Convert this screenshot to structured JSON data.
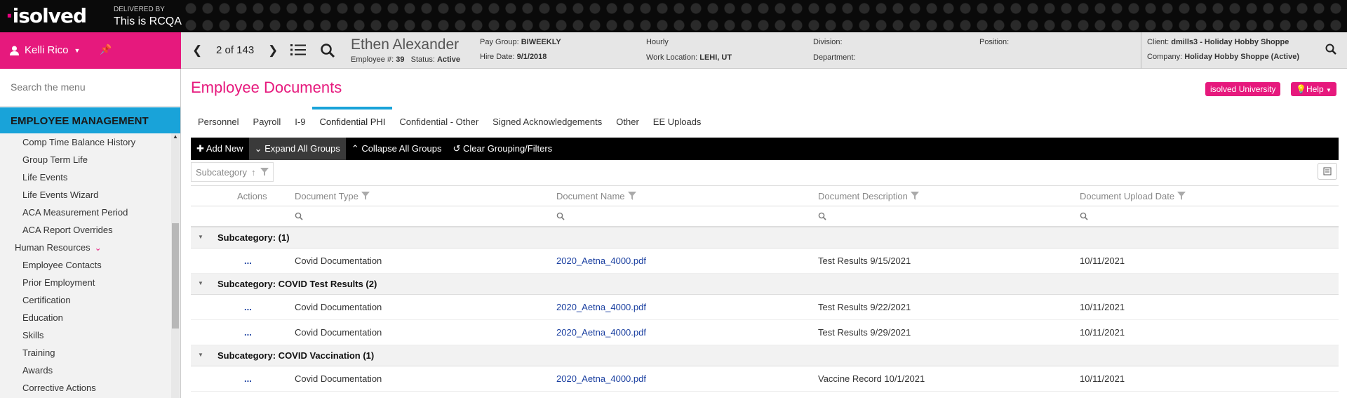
{
  "banner": {
    "logo": "isolved",
    "delivered_by": "DELIVERED BY",
    "tenant": "This is RCQA"
  },
  "user": {
    "name": "Kelli Rico"
  },
  "sidebar": {
    "search_placeholder": "Search the menu",
    "section": "EMPLOYEE MANAGEMENT",
    "items": [
      {
        "label": "Comp Time Balance History",
        "group": false
      },
      {
        "label": "Group Term Life",
        "group": false
      },
      {
        "label": "Life Events",
        "group": false
      },
      {
        "label": "Life Events Wizard",
        "group": false
      },
      {
        "label": "ACA Measurement Period",
        "group": false
      },
      {
        "label": "ACA Report Overrides",
        "group": false
      },
      {
        "label": "Human Resources",
        "group": true
      },
      {
        "label": "Employee Contacts",
        "group": false
      },
      {
        "label": "Prior Employment",
        "group": false
      },
      {
        "label": "Certification",
        "group": false
      },
      {
        "label": "Education",
        "group": false
      },
      {
        "label": "Skills",
        "group": false
      },
      {
        "label": "Training",
        "group": false
      },
      {
        "label": "Awards",
        "group": false
      },
      {
        "label": "Corrective Actions",
        "group": false
      }
    ]
  },
  "employee": {
    "position_count": "2 of 143",
    "name": "Ethen Alexander",
    "emp_label": "Employee #:",
    "emp_number": "39",
    "status_label": "Status:",
    "status": "Active",
    "pay_group_label": "Pay Group:",
    "pay_group": "BIWEEKLY",
    "hire_date_label": "Hire Date:",
    "hire_date": "9/1/2018",
    "pay_type": "Hourly",
    "work_location_label": "Work Location:",
    "work_location": "LEHI, UT",
    "division_label": "Division:",
    "department_label": "Department:",
    "position_label": "Position:"
  },
  "client": {
    "client_label": "Client:",
    "client": "dmills3 - Holiday Hobby Shoppe",
    "company_label": "Company:",
    "company": "Holiday Hobby Shoppe (Active)"
  },
  "page": {
    "title": "Employee Documents",
    "university_btn": "isolved University",
    "help_btn": "Help"
  },
  "tabs": [
    {
      "label": "Personnel",
      "active": false
    },
    {
      "label": "Payroll",
      "active": false
    },
    {
      "label": "I-9",
      "active": false
    },
    {
      "label": "Confidential PHI",
      "active": true
    },
    {
      "label": "Confidential - Other",
      "active": false
    },
    {
      "label": "Signed Acknowledgements",
      "active": false
    },
    {
      "label": "Other",
      "active": false
    },
    {
      "label": "EE Uploads",
      "active": false
    }
  ],
  "toolbar": {
    "add_new": "Add New",
    "expand": "Expand All Groups",
    "collapse": "Collapse All Groups",
    "clear": "Clear Grouping/Filters"
  },
  "grouping": {
    "chip": "Subcategory"
  },
  "grid": {
    "columns": {
      "actions": "Actions",
      "doc_type": "Document Type",
      "doc_name": "Document Name",
      "doc_desc": "Document Description",
      "upload_date": "Document Upload Date"
    },
    "groups": [
      {
        "label": "Subcategory: (1)",
        "rows": [
          {
            "actions": "...",
            "type": "Covid Documentation",
            "name": "2020_Aetna_4000.pdf",
            "desc": "Test Results 9/15/2021",
            "date": "10/11/2021"
          }
        ]
      },
      {
        "label": "Subcategory: COVID Test Results (2)",
        "rows": [
          {
            "actions": "...",
            "type": "Covid Documentation",
            "name": "2020_Aetna_4000.pdf",
            "desc": "Test Results 9/22/2021",
            "date": "10/11/2021"
          },
          {
            "actions": "...",
            "type": "Covid Documentation",
            "name": "2020_Aetna_4000.pdf",
            "desc": "Test Results 9/29/2021",
            "date": "10/11/2021"
          }
        ]
      },
      {
        "label": "Subcategory: COVID Vaccination (1)",
        "rows": [
          {
            "actions": "...",
            "type": "Covid Documentation",
            "name": "2020_Aetna_4000.pdf",
            "desc": "Vaccine Record 10/1/2021",
            "date": "10/11/2021"
          }
        ]
      }
    ]
  },
  "colors": {
    "brand_pink": "#e6197d",
    "accent_blue": "#19a3d9",
    "link_blue": "#1a3fa0"
  }
}
